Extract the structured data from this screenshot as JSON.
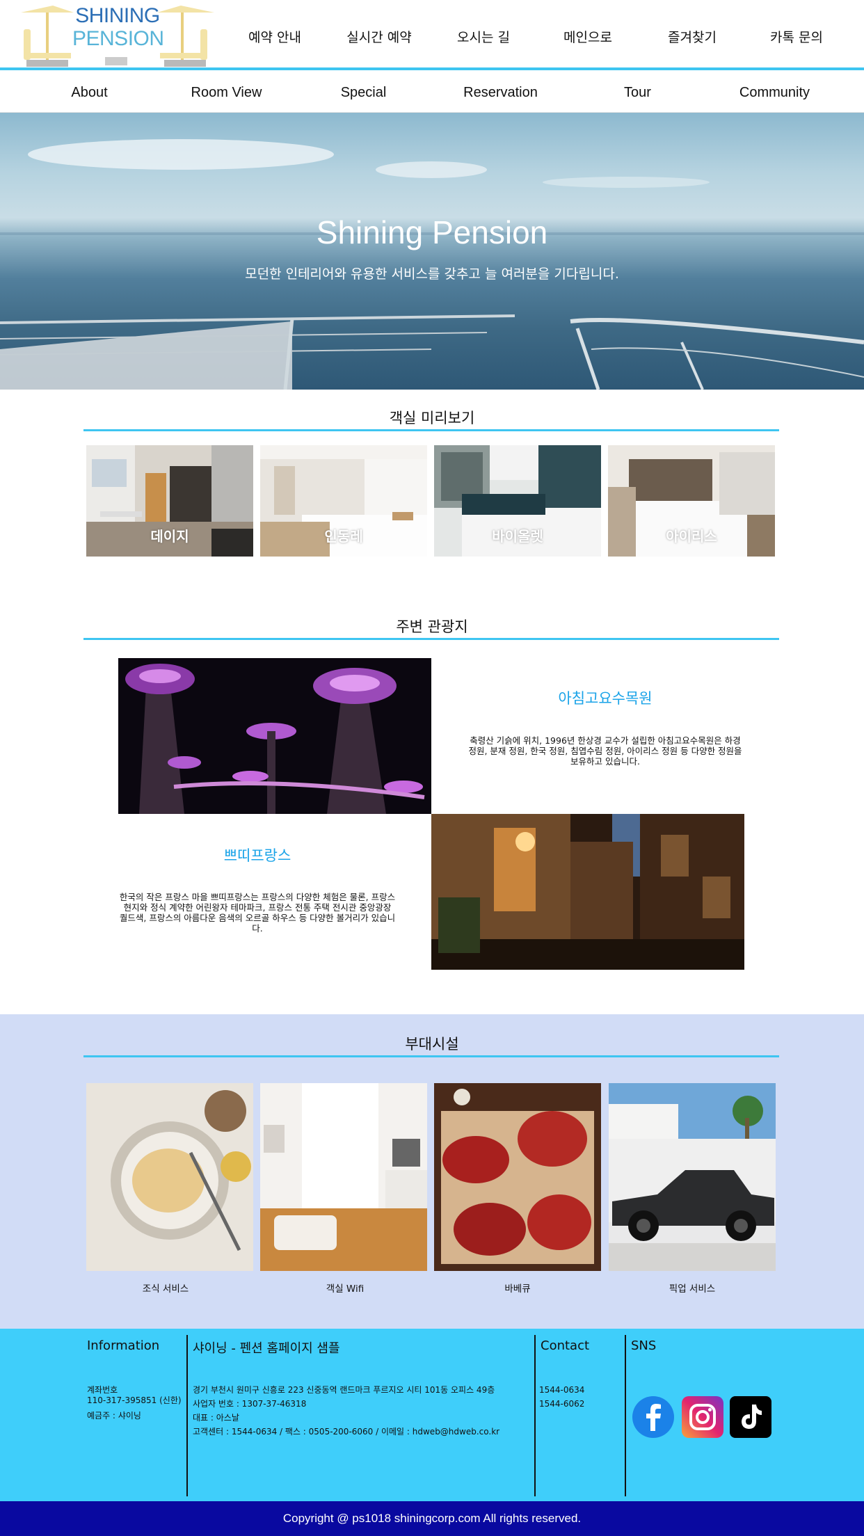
{
  "logo": {
    "line1": "SHINING",
    "line2": "PENSION"
  },
  "topnav": [
    "예약 안내",
    "실시간 예약",
    "오시는 길",
    "메인으로",
    "즐겨찾기",
    "카톡 문의"
  ],
  "subnav": [
    "About",
    "Room View",
    "Special",
    "Reservation",
    "Tour",
    "Community"
  ],
  "hero": {
    "title": "Shining Pension",
    "subtitle": "모던한 인테리어와 유용한 서비스를 갖추고 늘 여러분을 기다립니다."
  },
  "rooms": {
    "title": "객실 미리보기",
    "items": [
      "데이지",
      "인동레",
      "바이올렛",
      "아이리스"
    ]
  },
  "tour": {
    "title": "주변 관광지",
    "items": [
      {
        "name": "아침고요수목원",
        "desc": "축령산 기슭에 위치, 1996년 한상경 교수가 설립한 아침고요수목원은 하경 정원, 분재 정원, 한국 정원, 침엽수림 정원, 아이리스 정원 등 다양한 정원을 보유하고 있습니다."
      },
      {
        "name": "쁘띠프랑스",
        "desc": "한국의 작은 프랑스 마을 쁘띠프랑스는 프랑스의 다양한 체험은 물론, 프랑스 현지와 정식 계약한 어린왕자 테마파크, 프랑스 전통 주택 전시관 중앙광장 퀄드색, 프랑스의 아름다운 음색의 오르골 하우스 등 다양한 볼거리가 있습니다."
      }
    ]
  },
  "facilities": {
    "title": "부대시설",
    "items": [
      "조식 서비스",
      "객실 Wifi",
      "바베큐",
      "픽업 서비스"
    ]
  },
  "footer": {
    "info_title": "Information",
    "account_label": "계좌번호",
    "account_number": "110-317-395851 (신한)",
    "account_holder": "예금주 : 샤이닝",
    "site_title": "샤이닝 - 펜션 홈페이지 샘플",
    "address": "경기 부천시 원미구 신흥로 223 신중동역 랜드마크 푸르지오 시티 101동 오피스 49층",
    "business_no": "사업자 번호 : 1307-37-46318",
    "ceo": "대표 : 아스날",
    "contact_line": "고객센터 : 1544-0634   /   팩스 : 0505-200-6060   /   이메일 : hdweb@hdweb.co.kr",
    "contact_title": "Contact",
    "phone1": "1544-0634",
    "phone2": "1544-6062",
    "sns_title": "SNS",
    "sns": [
      "facebook-icon",
      "instagram-icon",
      "tiktok-icon"
    ]
  },
  "copyright": "Copyright @ ps1018 shiningcorp.com  All rights reserved.",
  "colors": {
    "accent": "#3ec5f1",
    "tour_name": "#1aa3e8",
    "facility_bg": "#d1dcf6",
    "footer_bg": "#3fcefa",
    "copyright_bg": "#0909a0"
  }
}
